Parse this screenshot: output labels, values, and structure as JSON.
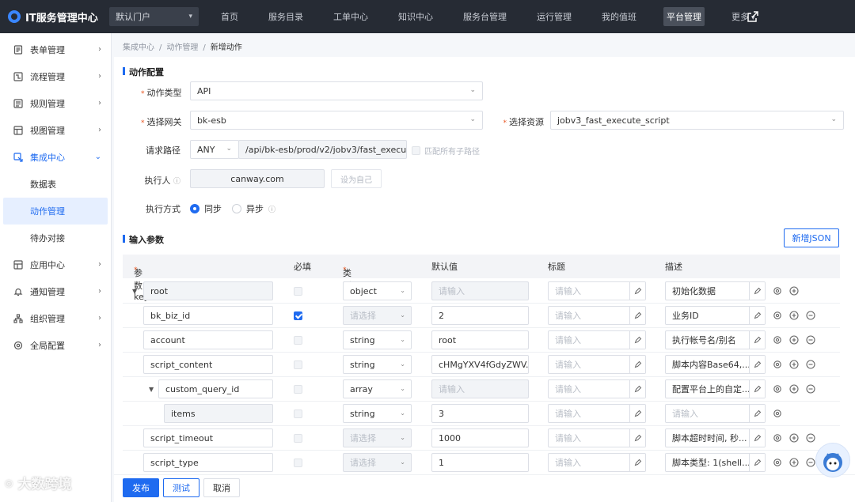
{
  "app": {
    "title": "IT服务管理中心",
    "portal": "默认门户"
  },
  "nav": [
    "首页",
    "服务目录",
    "工单中心",
    "知识中心",
    "服务台管理",
    "运行管理",
    "我的值班",
    "平台管理",
    "更多"
  ],
  "sidebar": {
    "items": [
      {
        "label": "表单管理",
        "icon": "form-icon"
      },
      {
        "label": "流程管理",
        "icon": "flow-icon"
      },
      {
        "label": "规则管理",
        "icon": "rule-icon"
      },
      {
        "label": "视图管理",
        "icon": "view-icon"
      },
      {
        "label": "集成中心",
        "icon": "integration-icon"
      }
    ],
    "sub": [
      "数据表",
      "动作管理",
      "待办对接"
    ],
    "items2": [
      {
        "label": "应用中心",
        "icon": "app-icon"
      },
      {
        "label": "通知管理",
        "icon": "bell-icon"
      },
      {
        "label": "组织管理",
        "icon": "org-icon"
      },
      {
        "label": "全局配置",
        "icon": "settings-icon"
      }
    ]
  },
  "breadcrumb": [
    "集成中心",
    "动作管理",
    "新增动作"
  ],
  "action_config": {
    "title": "动作配置",
    "type_label": "动作类型",
    "type_value": "API",
    "gateway_label": "选择网关",
    "gateway_value": "bk-esb",
    "resource_label": "选择资源",
    "resource_value": "jobv3_fast_execute_script",
    "path_label": "请求路径",
    "method": "ANY",
    "path_value": "/api/bk-esb/prod/v2/jobv3/fast_execut...",
    "match_all": "匹配所有子路径",
    "executor_label": "执行人",
    "executor_value": "canway.com",
    "set_self": "设为自己",
    "mode_label": "执行方式",
    "mode_sync": "同步",
    "mode_async": "异步"
  },
  "params": {
    "title": "输入参数",
    "add_json": "新增JSON",
    "headers": {
      "key": "参数key",
      "required": "必填",
      "type": "类型",
      "default": "默认值",
      "title": "标题",
      "desc": "描述"
    },
    "placeholder_input": "请输入",
    "placeholder_select": "请选择",
    "rows": [
      {
        "key": "root",
        "required": false,
        "type": "object",
        "default": "",
        "title": "",
        "desc": "初始化数据"
      },
      {
        "key": "bk_biz_id",
        "required": true,
        "type": "",
        "default": "2",
        "title": "",
        "desc": "业务ID"
      },
      {
        "key": "account",
        "required": false,
        "type": "string",
        "default": "root",
        "title": "",
        "desc": "执行帐号名/别名"
      },
      {
        "key": "script_content",
        "required": false,
        "type": "string",
        "default": "cHMgYXV4fGdyZWV...",
        "title": "",
        "desc": "脚本内容Base64,..."
      },
      {
        "key": "custom_query_id",
        "required": false,
        "type": "array",
        "default": "",
        "title": "",
        "desc": "配置平台上的自定..."
      },
      {
        "key": "items",
        "required": false,
        "type": "string",
        "default": "3",
        "title": "",
        "desc": ""
      },
      {
        "key": "script_timeout",
        "required": false,
        "type": "",
        "default": "1000",
        "title": "",
        "desc": "脚本超时时间, 秒..."
      },
      {
        "key": "script_type",
        "required": false,
        "type": "",
        "default": "1",
        "title": "",
        "desc": "脚本类型: 1(shell..."
      }
    ]
  },
  "footer": {
    "publish": "发布",
    "test": "测试",
    "cancel": "取消"
  },
  "watermark": "大数跨境",
  "colors": {
    "primary": "#1f6bf0",
    "topbar": "#262b34",
    "required": "#e8541e"
  }
}
